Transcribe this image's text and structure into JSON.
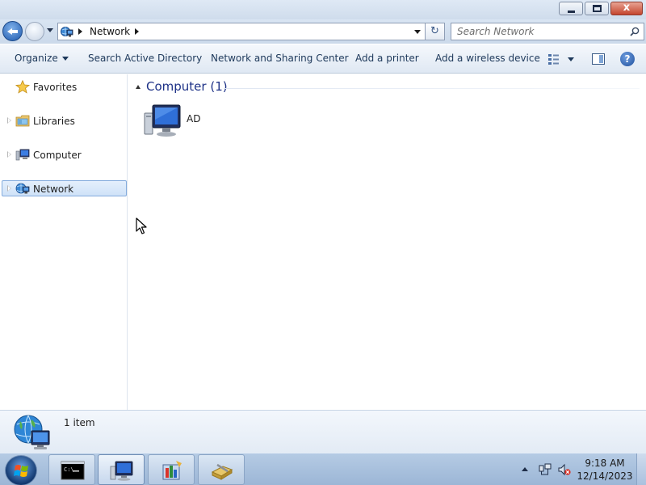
{
  "window": {
    "caption": {
      "minimize": "",
      "maximize": "",
      "close": "x"
    }
  },
  "navigation": {
    "address": {
      "segments": [
        "Network"
      ]
    },
    "refresh_glyph": "↻",
    "search": {
      "placeholder": "Search Network"
    }
  },
  "commands": {
    "organize": "Organize",
    "search_ad": "Search Active Directory",
    "network_center": "Network and Sharing Center",
    "add_printer": "Add a printer",
    "add_wireless": "Add a wireless device",
    "help_glyph": "?"
  },
  "sidebar": {
    "items": [
      {
        "label": "Favorites",
        "icon": "star-icon",
        "expandable": false,
        "selected": false
      },
      {
        "label": "Libraries",
        "icon": "libraries-icon",
        "expandable": true,
        "selected": false
      },
      {
        "label": "Computer",
        "icon": "computer-icon",
        "expandable": true,
        "selected": false
      },
      {
        "label": "Network",
        "icon": "network-icon",
        "expandable": true,
        "selected": true
      }
    ]
  },
  "content": {
    "group": {
      "title": "Computer (1)"
    },
    "items": [
      {
        "label": "AD",
        "icon": "computer-monitor-icon"
      }
    ]
  },
  "details": {
    "count_text": "1 item",
    "icon": "network-globe-icon"
  },
  "taskbar": {
    "buttons": [
      {
        "icon": "command-prompt-icon",
        "active": false
      },
      {
        "icon": "network-explorer-icon",
        "active": true
      },
      {
        "icon": "installer-icon",
        "active": false
      },
      {
        "icon": "tools-icon",
        "active": false
      }
    ],
    "clock": {
      "time": "9:18 AM",
      "date": "12/14/2023"
    }
  },
  "theme": {
    "accent": "#1e3287",
    "selection_bg": "#cfe2f8",
    "selection_border": "#84acdd",
    "taskbar": "#9cb6d6"
  }
}
